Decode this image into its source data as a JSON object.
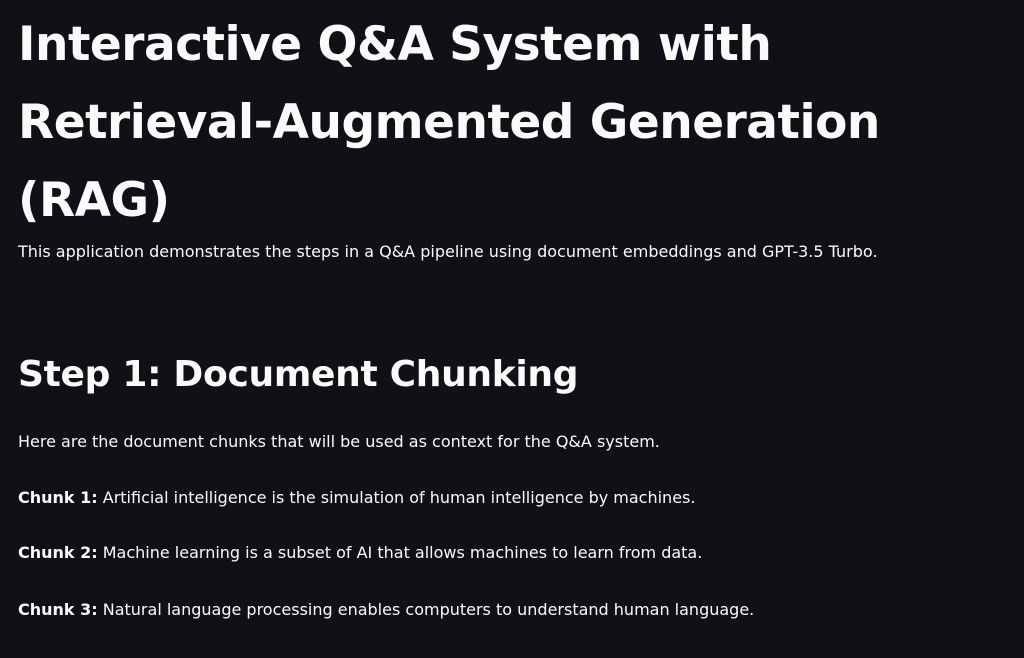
{
  "page": {
    "title": "Interactive Q&A System with Retrieval-Augmented Generation (RAG)",
    "intro": "This application demonstrates the steps in a Q&A pipeline using document embeddings and GPT-3.5 Turbo."
  },
  "step1": {
    "heading": "Step 1: Document Chunking",
    "description": "Here are the document chunks that will be used as context for the Q&A system.",
    "chunks": [
      {
        "label": "Chunk 1:",
        "text": " Artificial intelligence is the simulation of human intelligence by machines."
      },
      {
        "label": "Chunk 2:",
        "text": " Machine learning is a subset of AI that allows machines to learn from data."
      },
      {
        "label": "Chunk 3:",
        "text": " Natural language processing enables computers to understand human language."
      }
    ]
  },
  "colors": {
    "background": "#0f1117",
    "text": "#fafafa"
  }
}
